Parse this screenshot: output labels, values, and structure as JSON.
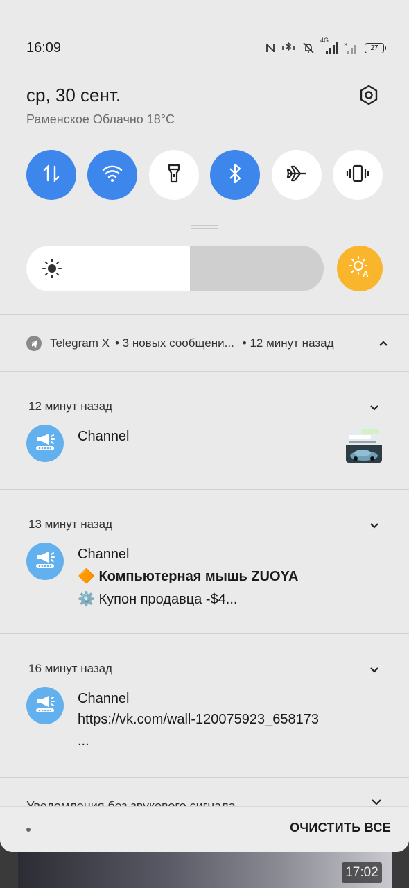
{
  "status_bar": {
    "time": "16:09",
    "network_label": "4G",
    "battery": "27",
    "icons": [
      "nfc-icon",
      "bluetooth-vibrate-icon",
      "bell-off-icon",
      "signal-4g-icon",
      "signal-icon",
      "battery-icon"
    ]
  },
  "header": {
    "date": "ср, 30 сент.",
    "weather": "Раменское Облачно 18°C"
  },
  "quick_tiles": [
    {
      "name": "mobile-data",
      "icon": "arrows-up-down-icon",
      "active": true
    },
    {
      "name": "wifi",
      "icon": "wifi-icon",
      "active": true
    },
    {
      "name": "flashlight",
      "icon": "flashlight-icon",
      "active": false
    },
    {
      "name": "bluetooth",
      "icon": "bluetooth-icon",
      "active": true
    },
    {
      "name": "airplane-mode",
      "icon": "airplane-icon",
      "active": false
    },
    {
      "name": "vibrate",
      "icon": "vibrate-icon",
      "active": false
    }
  ],
  "brightness": {
    "level": 0.55,
    "auto_icon": "auto-brightness-icon"
  },
  "colors": {
    "active_tile": "#3d86ec",
    "auto_button": "#f9b52c",
    "avatar": "#62b1ee"
  },
  "group": {
    "app": "Telegram X",
    "summary": "• 3 новых сообщени...",
    "time": "• 12 минут назад"
  },
  "notifications": [
    {
      "time": "12 минут назад",
      "title": "Channel",
      "lines": [],
      "has_thumbnail": true
    },
    {
      "time": "13 минут назад",
      "title": "Channel",
      "line1": "🔶 Компьютерная мышь ZUOYA",
      "line2": "⚙️ Купон продавца -$4..."
    },
    {
      "time": "16 минут назад",
      "title": "Channel",
      "line1": "https://vk.com/wall-120075923_658173",
      "line2": "..."
    }
  ],
  "silent_section": {
    "label": "Уведомления без звукового сигнала"
  },
  "footer": {
    "clear_all": "ОЧИСТИТЬ ВСЕ"
  },
  "background": {
    "clock": "17:02"
  }
}
